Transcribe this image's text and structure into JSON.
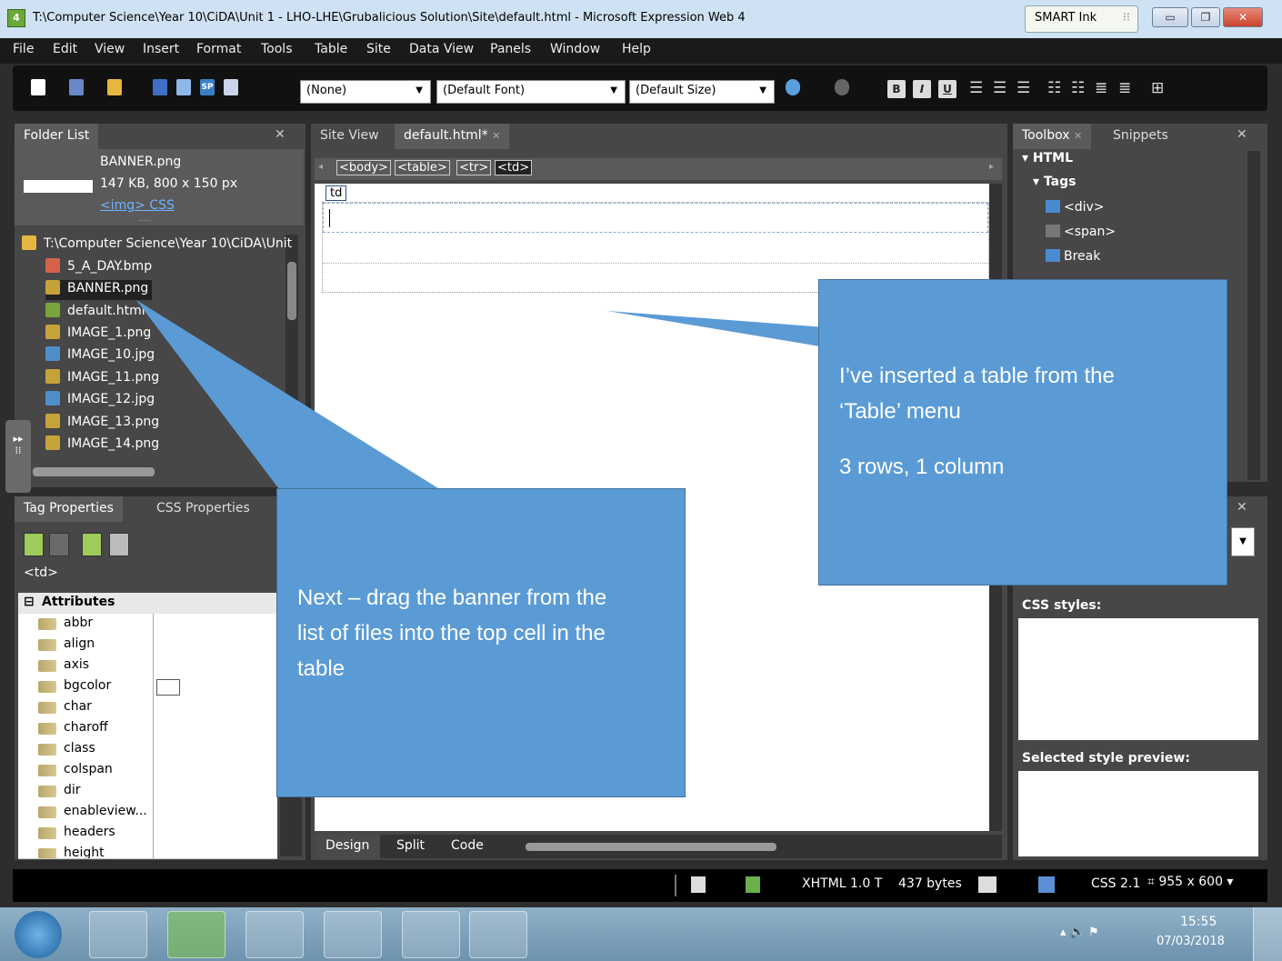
{
  "window": {
    "app_icon_text": "4",
    "title": "T:\\Computer Science\\Year 10\\CiDA\\Unit 1 - LHO-LHE\\Grubalicious Solution\\Site\\default.html - Microsoft Expression Web 4",
    "smart_ink": "SMART Ink"
  },
  "menu": [
    "File",
    "Edit",
    "View",
    "Insert",
    "Format",
    "Tools",
    "Table",
    "Site",
    "Data View",
    "Panels",
    "Window",
    "Help"
  ],
  "toolbar": {
    "style_dropdown": "(None)",
    "font_dropdown": "(Default Font)",
    "size_dropdown": "(Default Size)",
    "bold": "B",
    "italic": "I",
    "underline": "U"
  },
  "folder_list": {
    "title": "Folder List",
    "preview": {
      "name": "BANNER.png",
      "info": "147 KB, 800 x 150 px",
      "links": "<img> CSS",
      "dots": "....."
    },
    "root": "T:\\Computer Science\\Year 10\\CiDA\\Unit",
    "files": [
      "5_A_DAY.bmp",
      "BANNER.png",
      "default.html",
      "IMAGE_1.png",
      "IMAGE_10.jpg",
      "IMAGE_11.png",
      "IMAGE_12.jpg",
      "IMAGE_13.png",
      "IMAGE_14.png"
    ]
  },
  "editor": {
    "tabs": [
      "Site View",
      "default.html*"
    ],
    "tag_selector": [
      "<body>",
      "<table>",
      "<tr>",
      "<td>"
    ],
    "cell_label": "td",
    "view_tabs": [
      "Design",
      "Split",
      "Code"
    ]
  },
  "toolbox": {
    "tabs": [
      "Toolbox",
      "Snippets"
    ],
    "sections": {
      "html": "HTML",
      "tags": "Tags"
    },
    "items": [
      "<div>",
      "<span>",
      "Break"
    ]
  },
  "tag_properties": {
    "tabs": [
      "Tag Properties",
      "CSS Properties"
    ],
    "current_tag": "<td>",
    "section": "Attributes",
    "attributes": [
      "abbr",
      "align",
      "axis",
      "bgcolor",
      "char",
      "charoff",
      "class",
      "colspan",
      "dir",
      "enableview...",
      "headers",
      "height"
    ]
  },
  "css_panel": {
    "css_styles": "CSS styles:",
    "preview": "Selected style preview:"
  },
  "status": {
    "doctype": "XHTML 1.0 T",
    "size": "437 bytes",
    "css": "CSS 2.1",
    "dimensions": "955 x 600"
  },
  "clock": {
    "time": "15:55",
    "date": "07/03/2018"
  },
  "callouts": {
    "right": {
      "line1": "I’ve inserted a table from the",
      "line2": "‘Table’ menu",
      "line3": "3 rows, 1 column"
    },
    "left": {
      "line1": "Next – drag the banner from the",
      "line2": "list of files into the top cell in the",
      "line3": "table"
    }
  }
}
